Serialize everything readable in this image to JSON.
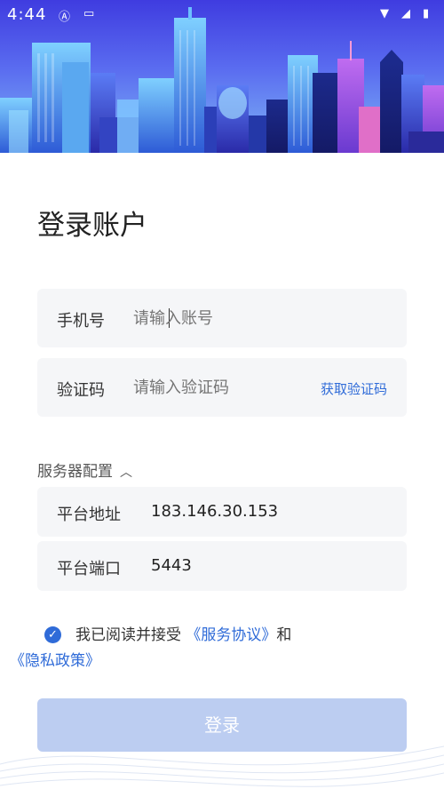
{
  "status_bar": {
    "time": "4:44",
    "icons": [
      "notification-a-icon",
      "sd-card-icon",
      "wifi-icon",
      "signal-icon",
      "battery-icon"
    ]
  },
  "page": {
    "title": "登录账户"
  },
  "phone": {
    "label": "手机号",
    "placeholder": "请输入账号"
  },
  "code": {
    "label": "验证码",
    "placeholder": "请输入验证码",
    "get_code": "获取验证码"
  },
  "server_config": {
    "toggle_label": "服务器配置",
    "expanded": true,
    "platform_address": {
      "label": "平台地址",
      "value": "183.146.30.153"
    },
    "platform_port": {
      "label": "平台端口",
      "value": "5443"
    }
  },
  "agreement": {
    "checked": true,
    "prefix": "我已阅读并接受",
    "service_link": "《服务协议》",
    "conjunction": "和",
    "privacy_link": "《隐私政策》"
  },
  "login_button": "登录",
  "colors": {
    "accent": "#2f6bd8",
    "field_bg": "#f5f6f8",
    "login_disabled": "#bccdf1"
  }
}
